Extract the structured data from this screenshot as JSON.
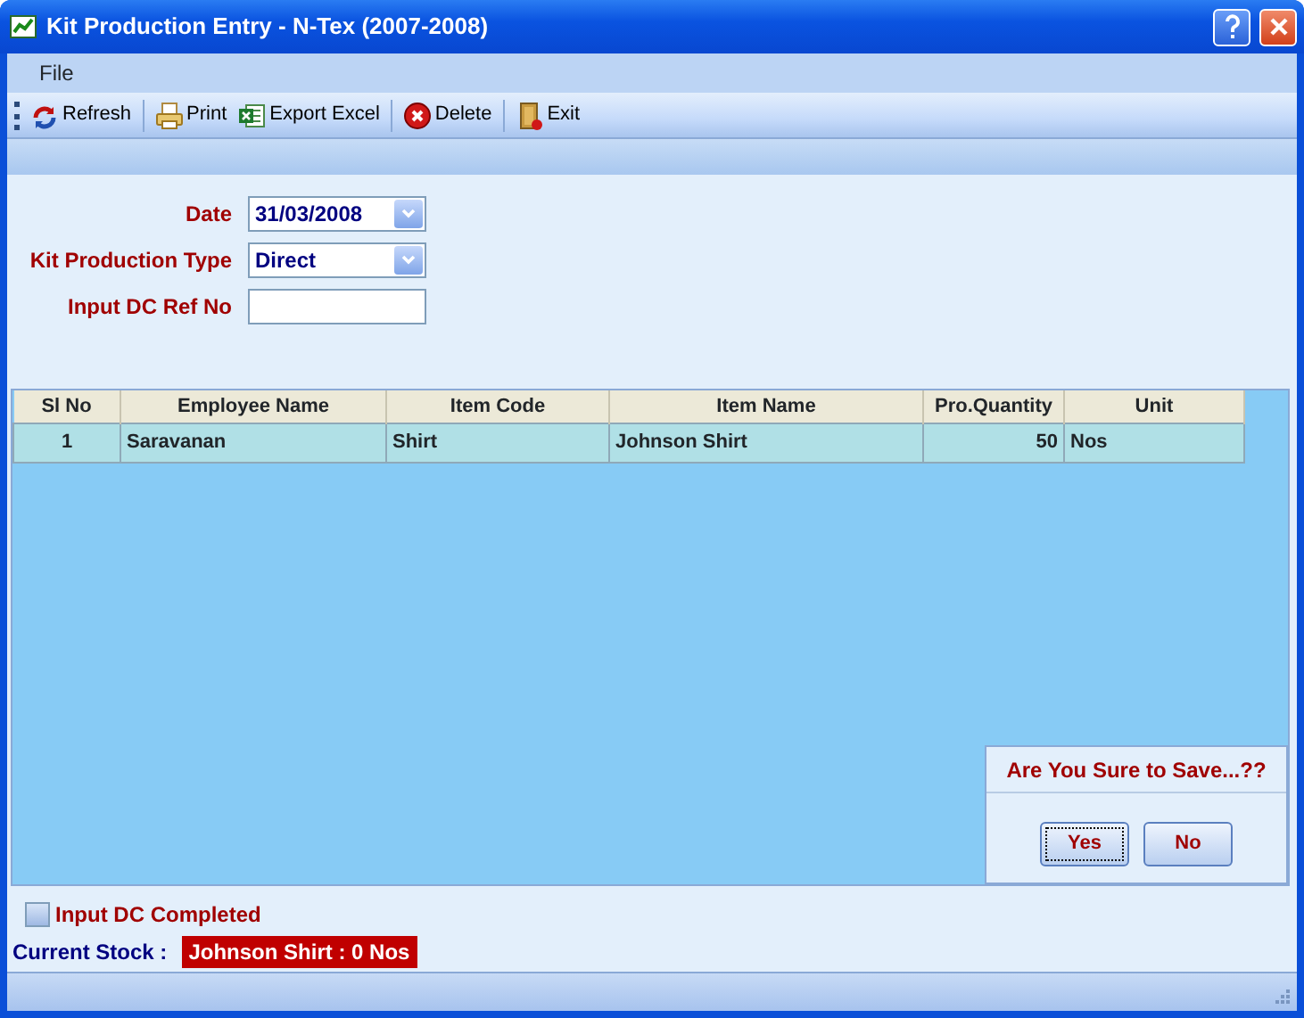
{
  "window": {
    "title": "Kit Production Entry - N-Tex (2007-2008)"
  },
  "menu": [
    "File"
  ],
  "toolbar": [
    [
      {
        "label": "Refresh"
      }
    ],
    [
      {
        "label": "Print"
      },
      {
        "label": "Export Excel"
      }
    ],
    [
      {
        "label": "Delete"
      }
    ],
    [
      {
        "label": "Exit"
      }
    ]
  ],
  "form": {
    "fields": [
      {
        "label": "Date",
        "kind": "dropdown",
        "value": "31/03/2008"
      },
      {
        "label": "Kit Production Type",
        "kind": "dropdown",
        "value": "Direct"
      },
      {
        "label": "Input DC Ref No",
        "kind": "text"
      }
    ]
  },
  "table": {
    "columns": [
      "Sl No",
      "Employee Name",
      "Item Code",
      "Item Name",
      "Pro.Quantity",
      "Unit"
    ],
    "rows": [
      [
        "1",
        "Saravanan",
        "Shirt",
        "Johnson Shirt",
        "50",
        "Nos"
      ]
    ]
  },
  "confirm_dialog": {
    "title": "Are You Sure to Save...??",
    "buttons": [
      {
        "label": "Yes",
        "focused": true
      },
      {
        "label": "No",
        "focused": false
      }
    ]
  },
  "input_dc_completed": {
    "label": "Input DC Completed",
    "checked": false
  },
  "current_stock": {
    "label": "Current Stock :",
    "value": "Johnson Shirt : 0 Nos"
  }
}
